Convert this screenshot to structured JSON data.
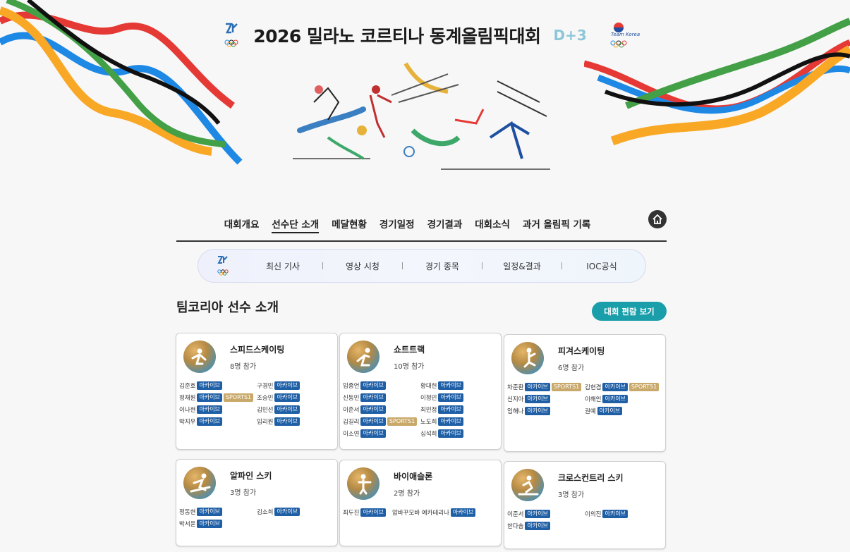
{
  "header": {
    "title": "2026 밀라노 코르티나 동계올림픽대회",
    "dday": "D+3",
    "team_logo_text": "Team Korea"
  },
  "gnb": {
    "items": [
      {
        "label": "대회개요"
      },
      {
        "label": "선수단 소개",
        "active": true
      },
      {
        "label": "메달현황"
      },
      {
        "label": "경기일정"
      },
      {
        "label": "경기결과"
      },
      {
        "label": "대회소식"
      },
      {
        "label": "과거 올림픽 기록"
      }
    ],
    "home_icon": "home-icon"
  },
  "subnav": {
    "items": [
      "최신 기사",
      "영상 시청",
      "경기 종목",
      "일정&결과",
      "IOC공식"
    ]
  },
  "section": {
    "title": "팀코리아 선수 소개",
    "overview_button": "대회 편람 보기"
  },
  "colors": {
    "accent": "#1a9eaa",
    "archive_badge": "#1f5fa6",
    "sports_badge": "#c9a96a"
  },
  "sports": [
    {
      "name": "스피드스케이팅",
      "count": "8명 참가",
      "icon": "speed-skating-icon",
      "athletes": [
        {
          "name": "김준호",
          "badges": [
            "아카이브"
          ]
        },
        {
          "name": "구경민",
          "badges": [
            "아카이브"
          ]
        },
        {
          "name": "정재원",
          "badges": [
            "아카이브",
            "SPORTS1"
          ]
        },
        {
          "name": "조승민",
          "badges": [
            "아카이브"
          ]
        },
        {
          "name": "이나현",
          "badges": [
            "아카이브"
          ]
        },
        {
          "name": "김민선",
          "badges": [
            "아카이브"
          ]
        },
        {
          "name": "박지우",
          "badges": [
            "아카이브"
          ]
        },
        {
          "name": "임리원",
          "badges": [
            "아카이브"
          ]
        }
      ]
    },
    {
      "name": "쇼트트랙",
      "count": "10명 참가",
      "icon": "short-track-icon",
      "athletes": [
        {
          "name": "임종언",
          "badges": [
            "아카이브"
          ]
        },
        {
          "name": "황대헌",
          "badges": [
            "아카이브"
          ]
        },
        {
          "name": "신동민",
          "badges": [
            "아카이브"
          ]
        },
        {
          "name": "이정민",
          "badges": [
            "아카이브"
          ]
        },
        {
          "name": "이준서",
          "badges": [
            "아카이브"
          ]
        },
        {
          "name": "최민정",
          "badges": [
            "아카이브"
          ]
        },
        {
          "name": "김길리",
          "badges": [
            "아카이브",
            "SPORTS1"
          ]
        },
        {
          "name": "노도희",
          "badges": [
            "아카이브"
          ]
        },
        {
          "name": "이소연",
          "badges": [
            "아카이브"
          ]
        },
        {
          "name": "심석희",
          "badges": [
            "아카이브"
          ]
        }
      ]
    },
    {
      "name": "피겨스케이팅",
      "count": "6명 참가",
      "icon": "figure-skating-icon",
      "athletes": [
        {
          "name": "차준환",
          "badges": [
            "아카이브",
            "SPORTS1"
          ]
        },
        {
          "name": "김현겸",
          "badges": [
            "아카이브",
            "SPORTS1"
          ]
        },
        {
          "name": "신지아",
          "badges": [
            "아카이브"
          ]
        },
        {
          "name": "이해인",
          "badges": [
            "아카이브"
          ]
        },
        {
          "name": "임해나",
          "badges": [
            "아카이브"
          ]
        },
        {
          "name": "권예",
          "badges": [
            "아카이브"
          ]
        }
      ]
    },
    {
      "name": "알파인 스키",
      "count": "3명 참가",
      "icon": "alpine-ski-icon",
      "athletes": [
        {
          "name": "정동현",
          "badges": [
            "아카이브"
          ]
        },
        {
          "name": "김소희",
          "badges": [
            "아카이브"
          ]
        },
        {
          "name": "박서윤",
          "badges": [
            "아카이브"
          ]
        }
      ]
    },
    {
      "name": "바이애슬론",
      "count": "2명 참가",
      "icon": "biathlon-icon",
      "athletes": [
        {
          "name": "최두진",
          "badges": [
            "아카이브"
          ]
        },
        {
          "name": "압바꾸모바 예카테리나",
          "badges": [
            "아카이브"
          ]
        }
      ]
    },
    {
      "name": "크로스컨트리 스키",
      "count": "3명 참가",
      "icon": "cross-country-ski-icon",
      "athletes": [
        {
          "name": "이준서",
          "badges": [
            "아카이브"
          ]
        },
        {
          "name": "이의진",
          "badges": [
            "아카이브"
          ]
        },
        {
          "name": "한다솜",
          "badges": [
            "아카이브"
          ]
        }
      ]
    }
  ]
}
